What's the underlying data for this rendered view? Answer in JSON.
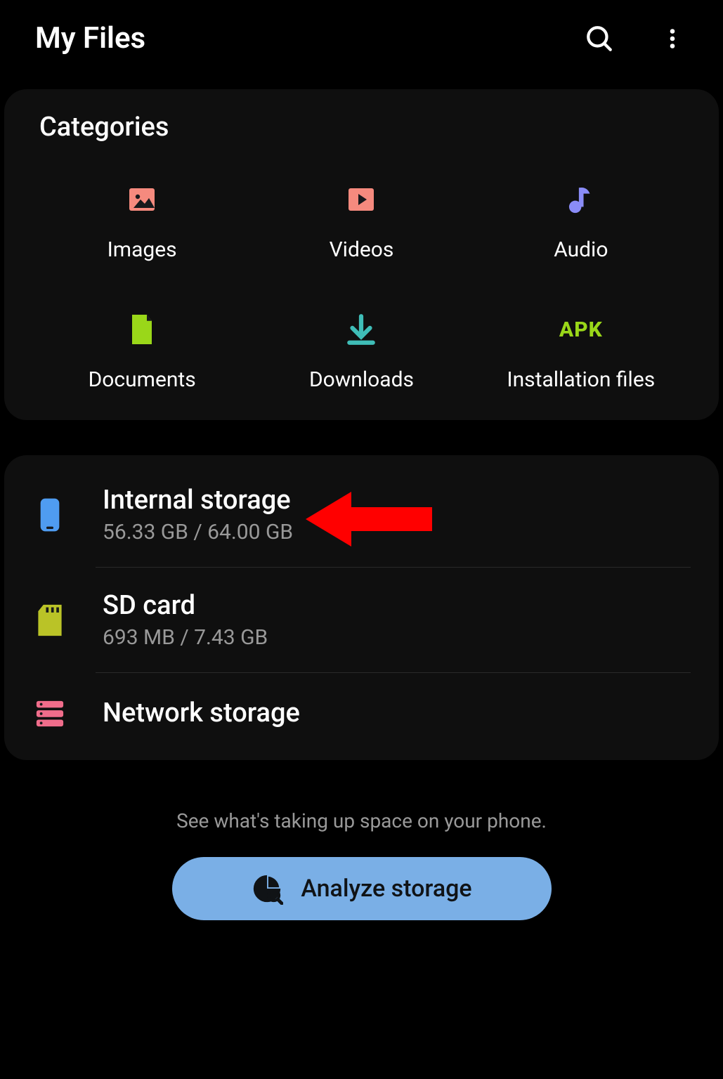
{
  "header": {
    "title": "My Files"
  },
  "categories": {
    "section_title": "Categories",
    "items": [
      {
        "label": "Images"
      },
      {
        "label": "Videos"
      },
      {
        "label": "Audio"
      },
      {
        "label": "Documents"
      },
      {
        "label": "Downloads"
      },
      {
        "label": "Installation files",
        "apk_text": "APK"
      }
    ]
  },
  "storage": {
    "internal": {
      "title": "Internal storage",
      "subtitle": "56.33 GB / 64.00 GB"
    },
    "sdcard": {
      "title": "SD card",
      "subtitle": "693 MB / 7.43 GB"
    },
    "network": {
      "title": "Network storage"
    }
  },
  "footer": {
    "hint": "See what's taking up space on your phone.",
    "analyze_label": "Analyze storage"
  },
  "colors": {
    "image_icon": "#f58a7e",
    "video_icon": "#f58a7e",
    "audio_icon": "#8a8cf7",
    "document_icon": "#9ad719",
    "download_icon": "#3fbdb7",
    "apk_icon": "#9ad719",
    "internal_icon": "#4f9cf1",
    "sd_icon": "#bac327",
    "network_icon": "#f06d8b",
    "analyze_bg": "#7aafe6",
    "arrow": "#ff0000"
  }
}
